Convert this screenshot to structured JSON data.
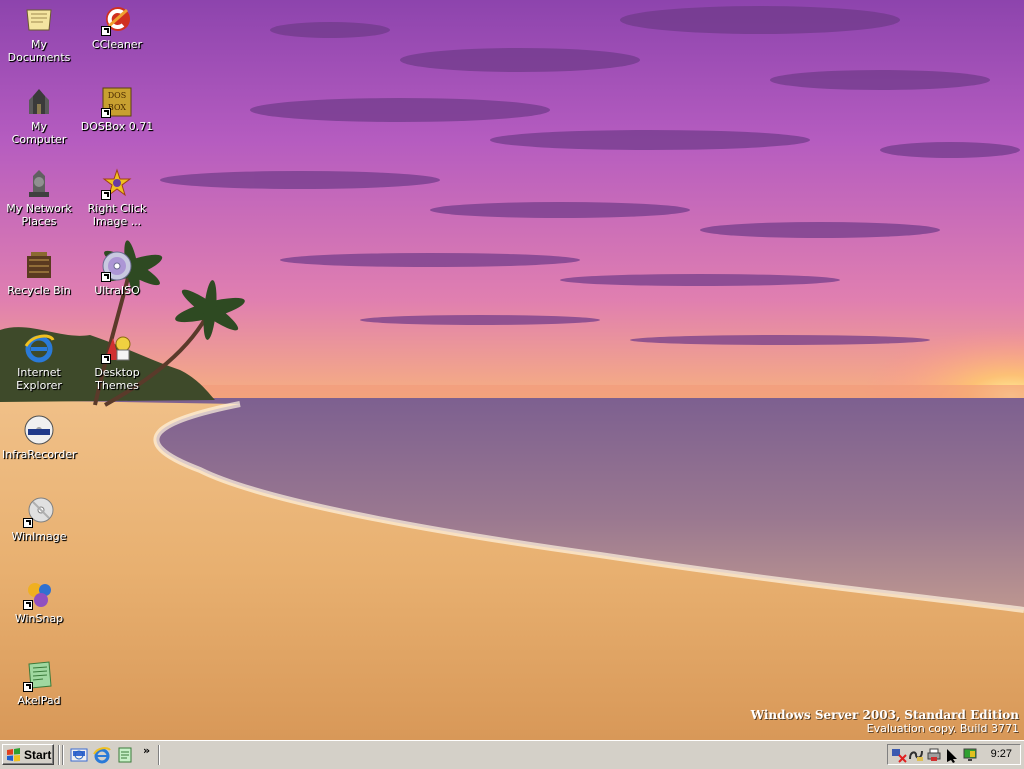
{
  "desktop": {
    "icons": [
      {
        "label": "My Documents",
        "icon": "my-documents-icon",
        "shortcut": false
      },
      {
        "label": "CCleaner",
        "icon": "ccleaner-icon",
        "shortcut": true
      },
      {
        "label": "My Computer",
        "icon": "my-computer-icon",
        "shortcut": false
      },
      {
        "label": "DOSBox 0.71",
        "icon": "dosbox-icon",
        "shortcut": true
      },
      {
        "label": "My Network Places",
        "icon": "network-places-icon",
        "shortcut": false
      },
      {
        "label": "Right Click Image ...",
        "icon": "right-click-image-icon",
        "shortcut": true
      },
      {
        "label": "Recycle Bin",
        "icon": "recycle-bin-icon",
        "shortcut": false
      },
      {
        "label": "UltraISO",
        "icon": "ultraiso-icon",
        "shortcut": true
      },
      {
        "label": "Internet Explorer",
        "icon": "internet-explorer-icon",
        "shortcut": false
      },
      {
        "label": "Desktop Themes",
        "icon": "desktop-themes-icon",
        "shortcut": true
      },
      {
        "label": "InfraRecorder",
        "icon": "infrarecorder-icon",
        "shortcut": false
      },
      {
        "label": "WinImage",
        "icon": "winimage-icon",
        "shortcut": true
      },
      {
        "label": "WinSnap",
        "icon": "winsnap-icon",
        "shortcut": true
      },
      {
        "label": "AkelPad",
        "icon": "akelpad-icon",
        "shortcut": true
      }
    ]
  },
  "watermark": {
    "line1": "Windows Server 2003, Standard Edition",
    "line2": "Evaluation copy. Build 3771"
  },
  "taskbar": {
    "start_label": "Start",
    "quick_launch": [
      "show-desktop-icon",
      "internet-explorer-icon",
      "notepad-icon"
    ],
    "quick_launch_more": "»",
    "tray_icons": [
      "network-disconnected-icon",
      "connection-icon",
      "printer-icon",
      "cursor-arrow-icon",
      "display-icon"
    ],
    "clock": "9:27"
  },
  "colors": {
    "taskbar_bg": "#d4d0c8",
    "sky_top": "#9a4fb4",
    "sky_horizon": "#f4a86a",
    "sea": "#8a6a9a",
    "sand": "#e8b070"
  }
}
